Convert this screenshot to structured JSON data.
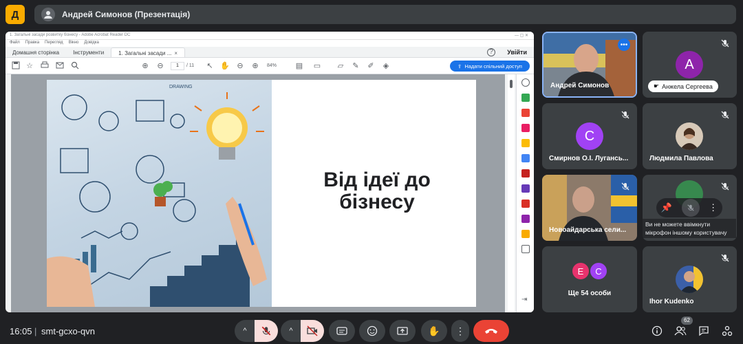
{
  "app": {
    "logo_letter": "Д"
  },
  "header": {
    "title": "Андрей Симонов (Презентація)"
  },
  "shared_screen": {
    "window_title": "1. Загальні засади розвитку бізнесу - Adobe Acrobat Reader DC",
    "menu": [
      "Файл",
      "Правка",
      "Перегляд",
      "Вікно",
      "Довідка"
    ],
    "tabs": [
      {
        "label": "Домашня сторінка"
      },
      {
        "label": "Інструменти"
      },
      {
        "label": "1. Загальні засади ..."
      }
    ],
    "tab_close": "×",
    "sign_in_label": "Увійти",
    "page_current": "1",
    "page_total": "/ 11",
    "zoom": "84%",
    "share_button_label": "Надати спільний доступ",
    "slide_title": "Від ідеї до бізнесу",
    "drawing_caption": "DRAWING"
  },
  "participants": [
    {
      "name": "Андрей Симонов",
      "type": "video",
      "speaking": true
    },
    {
      "name": "Анжела Сергеева",
      "type": "letter",
      "letter": "А",
      "color": "#8e24aa",
      "muted": true
    },
    {
      "name": "Смирнов О.І. Лугансь...",
      "type": "letter",
      "letter": "С",
      "color": "#a142f4",
      "muted": true
    },
    {
      "name": "Людмила Павлова",
      "type": "photo",
      "muted": true
    },
    {
      "name": "Новоайдарська сели...",
      "type": "video",
      "muted": true
    },
    {
      "name": "",
      "type": "hover",
      "tooltip": "Ви не можете ввімкнути мікрофон іншому користувачу",
      "muted": true
    },
    {
      "name": "Ще 54 особи",
      "type": "group",
      "letters": [
        "Е",
        "С"
      ],
      "colors": [
        "#e8336d",
        "#a142f4"
      ]
    },
    {
      "name": "Ihor Kudenko",
      "type": "photo",
      "muted": true
    }
  ],
  "bottom_bar": {
    "time": "16:05",
    "separator": "|",
    "meeting_code": "smt-gcxo-qvn",
    "people_count": "62",
    "caret": "^"
  }
}
